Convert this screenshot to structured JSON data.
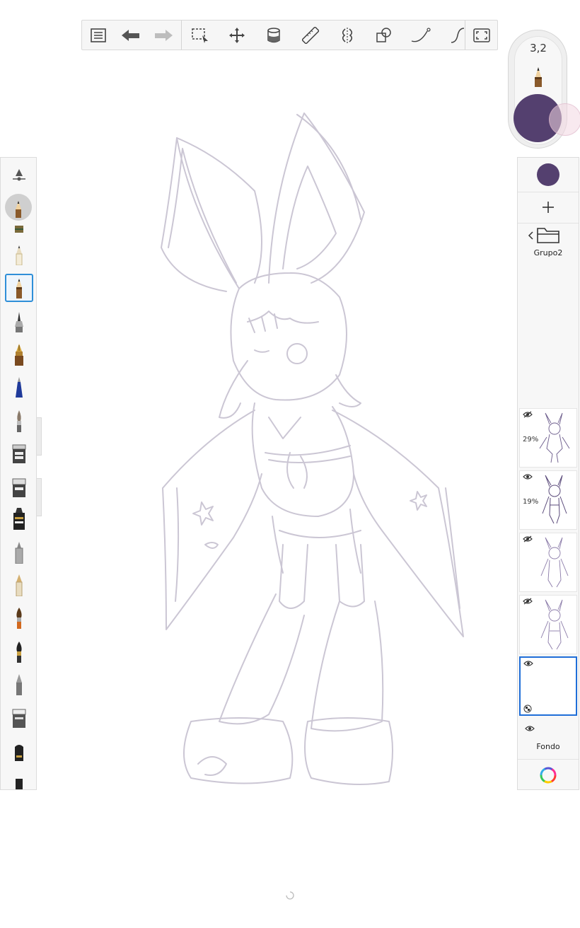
{
  "toolbar": {
    "tools": [
      "menu-icon",
      "undo-icon",
      "redo-icon",
      "selection-icon",
      "transform-icon",
      "fill-icon",
      "ruler-icon",
      "symmetry-icon",
      "shapes-icon",
      "stroke-icon",
      "curve-icon",
      "fullscreen-icon"
    ]
  },
  "brush_puck": {
    "size_label": "3,2",
    "color": "#54406f"
  },
  "layers_panel": {
    "current_color": "#54406f",
    "group_name": "Grupo2",
    "layers": [
      {
        "opacity_label": "29%",
        "visible": false
      },
      {
        "opacity_label": "19%",
        "visible": true
      },
      {
        "opacity_label": "",
        "visible": false
      },
      {
        "opacity_label": "",
        "visible": false
      },
      {
        "opacity_label": "",
        "visible": true,
        "selected": true
      }
    ],
    "background_label": "Fondo"
  },
  "colors": {
    "accent_selection": "#2f8fd8",
    "sketch_stroke": "#c9c4d2",
    "brush_color": "#54406f"
  }
}
